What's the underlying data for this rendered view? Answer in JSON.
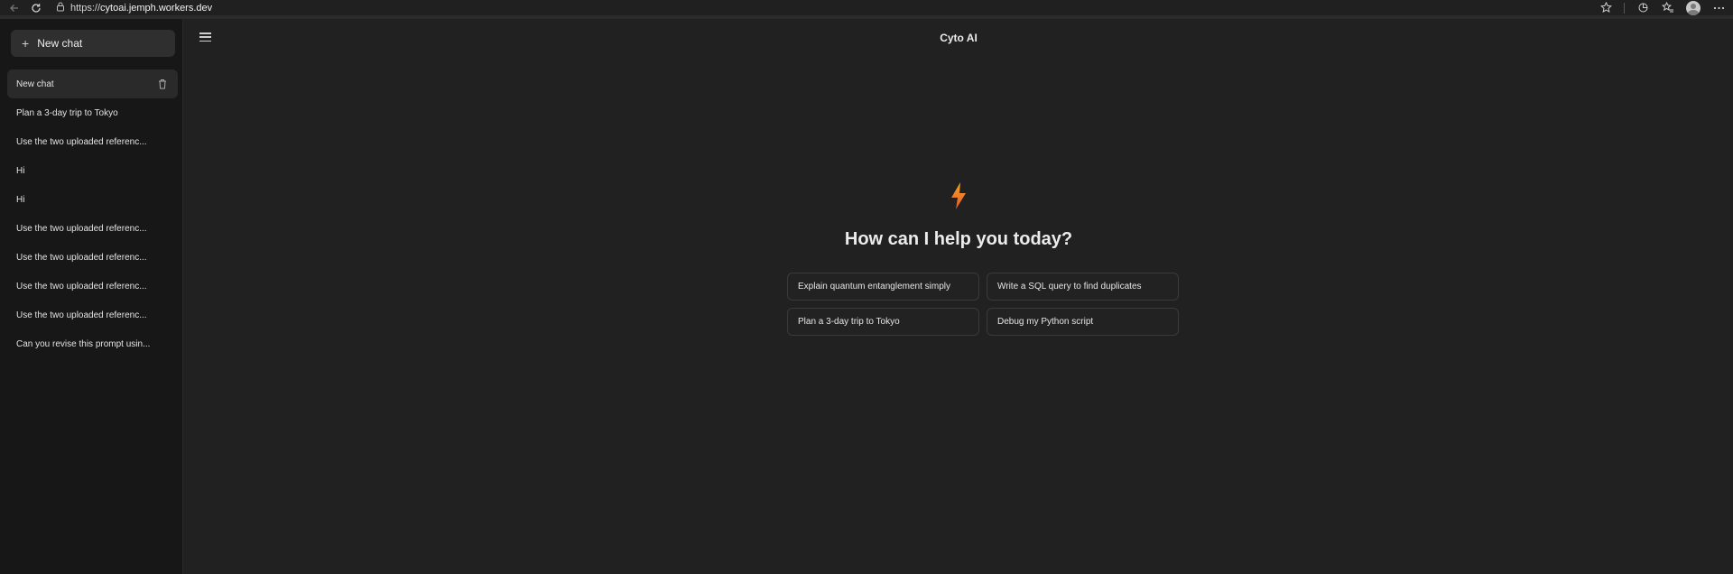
{
  "browser": {
    "url_prefix": "https://",
    "url_host": "cytoai.jemph.workers.dev"
  },
  "sidebar": {
    "new_chat_label": "New chat",
    "items": [
      {
        "label": "New chat",
        "active": true
      },
      {
        "label": "Plan a 3-day trip to Tokyo"
      },
      {
        "label": "Use the two uploaded referenc..."
      },
      {
        "label": "Hi"
      },
      {
        "label": "Hi"
      },
      {
        "label": "Use the two uploaded referenc..."
      },
      {
        "label": "Use the two uploaded referenc..."
      },
      {
        "label": "Use the two uploaded referenc..."
      },
      {
        "label": "Use the two uploaded referenc..."
      },
      {
        "label": "Can you revise this prompt usin..."
      }
    ]
  },
  "header": {
    "title": "Cyto AI"
  },
  "hero": {
    "greeting": "How can I help you today?",
    "icon": "lightning-bolt-icon"
  },
  "suggestions": [
    {
      "label": "Explain quantum entanglement simply"
    },
    {
      "label": "Write a SQL query to find duplicates"
    },
    {
      "label": "Plan a 3-day trip to Tokyo"
    },
    {
      "label": "Debug my Python script"
    }
  ],
  "colors": {
    "background": "#212121",
    "sidebar": "#171717",
    "bolt_top": "#f5a623",
    "bolt_bottom": "#e4572e"
  }
}
